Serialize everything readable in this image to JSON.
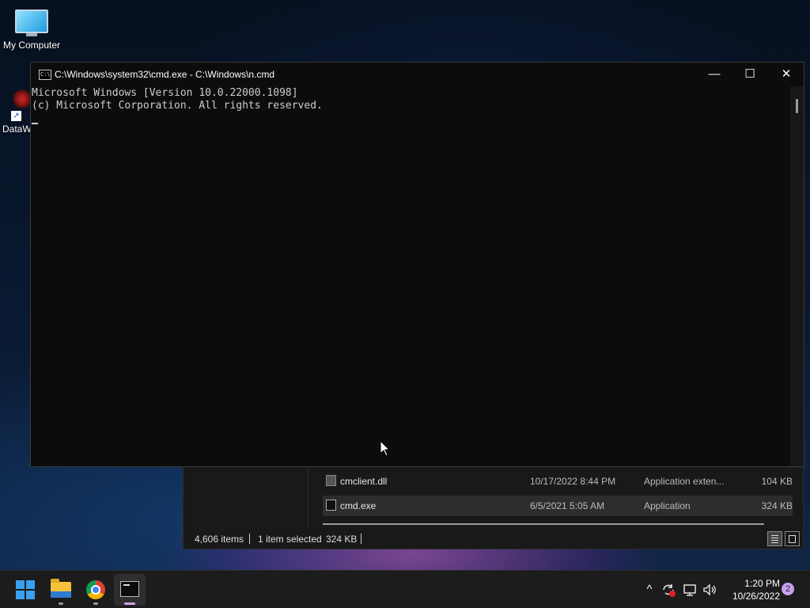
{
  "desktop": {
    "icons": [
      {
        "label": "My Computer",
        "icon": "monitor-icon"
      },
      {
        "label": "DataW",
        "icon": "datawd-shortcut-icon"
      }
    ]
  },
  "explorer": {
    "files": [
      {
        "name": "cmclient.dll",
        "date": "10/17/2022 8:44 PM",
        "type": "Application exten...",
        "size": "104 KB",
        "icon": "dll-file-icon"
      },
      {
        "name": "cmd.exe",
        "date": "6/5/2021 5:05 AM",
        "type": "Application",
        "size": "324 KB",
        "icon": "cmd-app-icon",
        "selected": true
      }
    ],
    "status": {
      "items_count": "4,606 items",
      "selection": "1 item selected",
      "selection_size": "324 KB"
    }
  },
  "cmd": {
    "title": "C:\\Windows\\system32\\cmd.exe - C:\\Windows\\n.cmd",
    "lines": [
      "Microsoft Windows [Version 10.0.22000.1098]",
      "(c) Microsoft Corporation. All rights reserved."
    ],
    "controls": {
      "minimize": "—",
      "maximize": "☐",
      "close": "✕"
    }
  },
  "taskbar": {
    "apps": [
      {
        "name": "Start",
        "icon": "windows-start-icon"
      },
      {
        "name": "File Explorer",
        "icon": "folder-icon"
      },
      {
        "name": "Google Chrome",
        "icon": "chrome-icon"
      },
      {
        "name": "Command Prompt",
        "icon": "terminal-icon",
        "active": true
      }
    ],
    "tray": {
      "chevron": "^",
      "time": "1:20 PM",
      "date": "10/26/2022",
      "notification_count": "2"
    }
  }
}
